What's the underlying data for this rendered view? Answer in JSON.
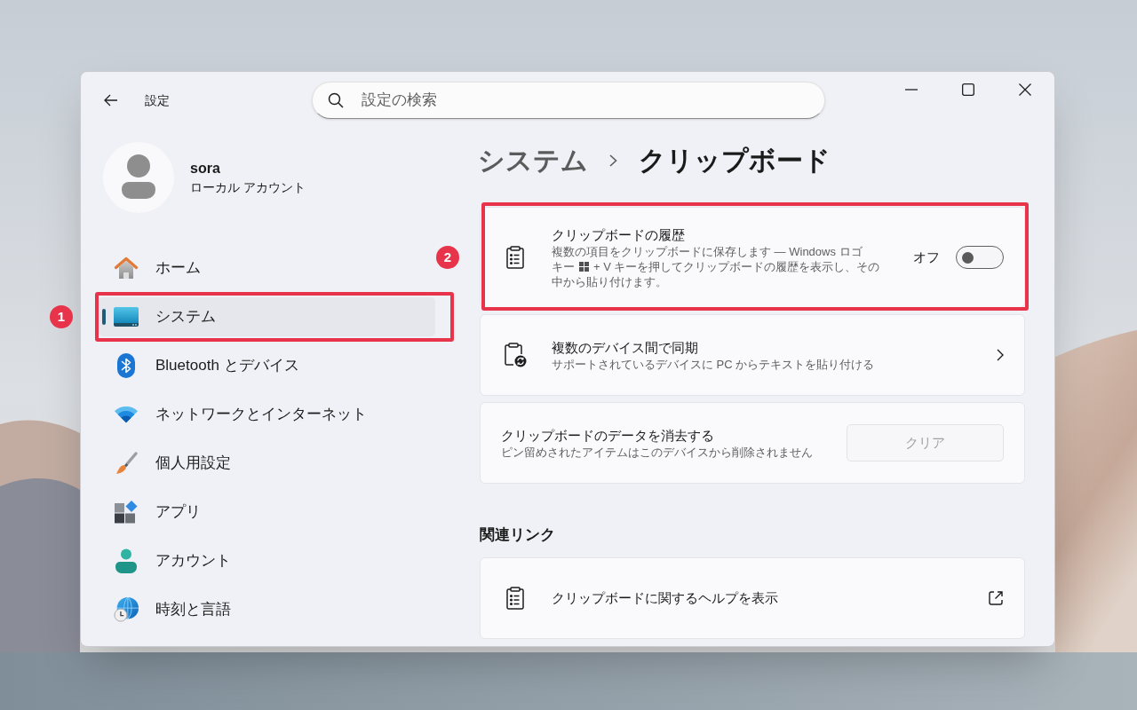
{
  "window": {
    "title": "設定"
  },
  "search": {
    "placeholder": "設定の検索"
  },
  "account": {
    "name": "sora",
    "type": "ローカル アカウント"
  },
  "sidebar": {
    "items": [
      {
        "label": "ホーム",
        "selected": false,
        "highlighted": false
      },
      {
        "label": "システム",
        "selected": true,
        "highlighted": true,
        "badge": "1"
      },
      {
        "label": "Bluetooth とデバイス",
        "selected": false,
        "highlighted": false
      },
      {
        "label": "ネットワークとインターネット",
        "selected": false,
        "highlighted": false
      },
      {
        "label": "個人用設定",
        "selected": false,
        "highlighted": false
      },
      {
        "label": "アプリ",
        "selected": false,
        "highlighted": false
      },
      {
        "label": "アカウント",
        "selected": false,
        "highlighted": false
      },
      {
        "label": "時刻と言語",
        "selected": false,
        "highlighted": false
      }
    ]
  },
  "breadcrumb": {
    "parent": "システム",
    "current": "クリップボード"
  },
  "settings": [
    {
      "kind": "toggle",
      "title": "クリップボードの履歴",
      "description_lines": [
        [
          {
            "kind": "text",
            "text": "複数の項目をクリップボードに保存します — Windows ロゴ"
          }
        ],
        [
          {
            "kind": "text",
            "text": "キー"
          },
          {
            "kind": "logo_key"
          },
          {
            "kind": "text",
            "text": "+ V キーを押してクリップボードの履歴を表示し、その"
          }
        ],
        [
          {
            "kind": "text",
            "text": "中から貼り付けます。"
          }
        ]
      ],
      "state_label": "オフ",
      "on": false,
      "highlighted": true,
      "badge": "2"
    },
    {
      "kind": "link",
      "title": "複数のデバイス間で同期",
      "description": "サポートされているデバイスに PC からテキストを貼り付ける",
      "highlighted": false
    },
    {
      "kind": "button",
      "title": "クリップボードのデータを消去する",
      "description": "ピン留めされたアイテムはこのデバイスから削除されません",
      "button": {
        "label": "クリア",
        "disabled": true
      },
      "highlighted": false
    }
  ],
  "related_links": {
    "heading": "関連リンク",
    "items": [
      {
        "label": "クリップボードに関するヘルプを表示"
      }
    ]
  }
}
